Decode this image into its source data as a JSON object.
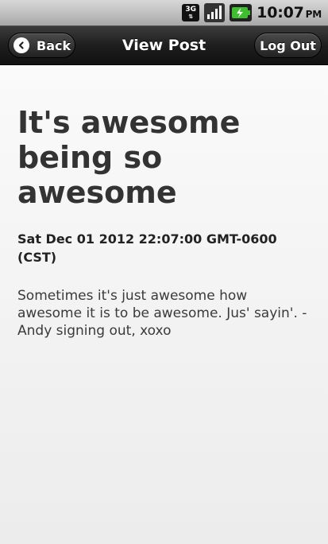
{
  "status_bar": {
    "network_label": "3G",
    "time": "10:07",
    "ampm": "PM",
    "icons": [
      "3g-data-icon",
      "signal-icon",
      "battery-charging-icon"
    ]
  },
  "header": {
    "title": "View Post",
    "back_label": "Back",
    "logout_label": "Log Out"
  },
  "post": {
    "title": "It's awesome being so awesome",
    "date": "Sat Dec 01 2012 22:07:00 GMT-0600 (CST)",
    "body": "Sometimes it's just awesome how awesome it is to be awesome. Jus' sayin'. -Andy signing out, xoxo"
  },
  "colors": {
    "header": "#1e1e1e",
    "content_bg": "#f5f5f5",
    "battery_accent": "#3fbf2f"
  }
}
